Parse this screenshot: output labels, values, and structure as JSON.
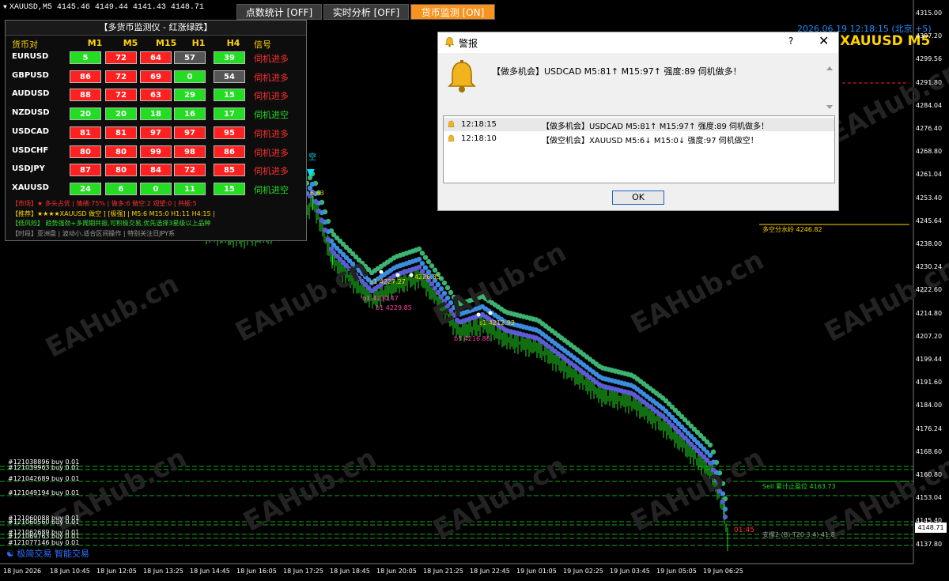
{
  "symbol_info": "XAUUSD,M5  4145.46 4149.44 4141.43 4148.71",
  "toggles": [
    {
      "label": "点数统计 [OFF]",
      "state": "off"
    },
    {
      "label": "实时分析 [OFF]",
      "state": "off"
    },
    {
      "label": "货币监测 [ON]",
      "state": "on"
    }
  ],
  "chart_date_label": "2026.06.19 12:18:15 (北京 +5)",
  "chart_title": "XAUUSD M5",
  "monitor": {
    "title": "【多货币监测仪 - 红涨绿跌】",
    "headers": [
      "货币对",
      "M1",
      "M5",
      "M15",
      "H1",
      "H4",
      "信号"
    ],
    "rows": [
      {
        "pair": "EURUSD",
        "vals": [
          "5",
          "72",
          "64",
          "57",
          "39"
        ],
        "colors": [
          "green",
          "red",
          "red",
          "gray",
          "green"
        ],
        "signal": "伺机进多",
        "sigcolor": "red"
      },
      {
        "pair": "GBPUSD",
        "vals": [
          "86",
          "72",
          "69",
          "0",
          "54"
        ],
        "colors": [
          "red",
          "red",
          "red",
          "green",
          "gray"
        ],
        "signal": "伺机进多",
        "sigcolor": "red"
      },
      {
        "pair": "AUDUSD",
        "vals": [
          "88",
          "72",
          "63",
          "29",
          "15"
        ],
        "colors": [
          "red",
          "red",
          "red",
          "green",
          "green"
        ],
        "signal": "伺机进多",
        "sigcolor": "red"
      },
      {
        "pair": "NZDUSD",
        "vals": [
          "20",
          "20",
          "18",
          "16",
          "17"
        ],
        "colors": [
          "green",
          "green",
          "green",
          "green",
          "green"
        ],
        "signal": "伺机进空",
        "sigcolor": "green"
      },
      {
        "pair": "USDCAD",
        "vals": [
          "81",
          "81",
          "97",
          "97",
          "95"
        ],
        "colors": [
          "red",
          "red",
          "red",
          "red",
          "red"
        ],
        "signal": "伺机进多",
        "sigcolor": "red"
      },
      {
        "pair": "USDCHF",
        "vals": [
          "80",
          "80",
          "99",
          "98",
          "86"
        ],
        "colors": [
          "red",
          "red",
          "red",
          "red",
          "red"
        ],
        "signal": "伺机进多",
        "sigcolor": "red"
      },
      {
        "pair": "USDJPY",
        "vals": [
          "87",
          "80",
          "84",
          "72",
          "85"
        ],
        "colors": [
          "red",
          "red",
          "red",
          "red",
          "red"
        ],
        "signal": "伺机进多",
        "sigcolor": "red"
      },
      {
        "pair": "XAUUSD",
        "vals": [
          "24",
          "6",
          "0",
          "11",
          "15"
        ],
        "colors": [
          "green",
          "green",
          "green",
          "green",
          "green"
        ],
        "signal": "伺机进空",
        "sigcolor": "green"
      }
    ],
    "notes": [
      {
        "text": "【市场】★ 多头占优 | 情绪:75% | 做多:6 做空:2 观望:0 | 共振:5",
        "color": "#ff3030"
      },
      {
        "text": "【推荐】★★★★XAUUSD 做空 ] [极强] | M5:6 M15:0 H1:11 H4:15 |",
        "color": "#ffd400"
      },
      {
        "text": "【低风险】 趋势强劲+多周期共振,可积极交易,优先选择3星级以上品种",
        "color": "#30e030"
      },
      {
        "text": "【时段】亚洲盘 | 波动小,适合区间操作 | 特别关注日JPY系",
        "color": "#9a9a9a"
      }
    ]
  },
  "alert": {
    "title": "警报",
    "help": "?",
    "close": "✕",
    "message": "【做多机会】USDCAD M5:81↑ M15:97↑ 强度:89 伺机做多！",
    "list": [
      {
        "time": "12:18:15",
        "msg": "【做多机会】USDCAD M5:81↑ M15:97↑ 强度:89 伺机做多！"
      },
      {
        "time": "12:18:10",
        "msg": "【做空机会】XAUUSD M5:6↓ M15:0↓ 强度:97 伺机做空！"
      }
    ],
    "ok": "OK"
  },
  "price_axis": [
    "4315.00",
    "4307.20",
    "4299.56",
    "4291.80",
    "4284.04",
    "4276.40",
    "4268.80",
    "4261.04",
    "4253.40",
    "4245.64",
    "4238.00",
    "4230.24",
    "4222.60",
    "4214.80",
    "4207.20",
    "4199.44",
    "4191.60",
    "4184.00",
    "4176.24",
    "4168.60",
    "4160.80",
    "4153.04",
    "4145.40",
    "4137.80"
  ],
  "current_price": "4148.71",
  "time_axis": [
    "18 Jun 2026",
    "18 Jun 10:45",
    "18 Jun 12:05",
    "18 Jun 13:25",
    "18 Jun 14:45",
    "18 Jun 16:05",
    "18 Jun 17:25",
    "18 Jun 18:45",
    "18 Jun 20:05",
    "18 Jun 21:25",
    "18 Jun 22:45",
    "19 Jun 01:05",
    "19 Jun 02:25",
    "19 Jun 03:45",
    "19 Jun 05:05",
    "19 Jun 06:25"
  ],
  "orders": [
    "#121038896 buy 0.01",
    "#121039963 buy 0.01",
    "#121042689 buy 0.01",
    "#121049194 buy 0.01",
    "#121060088 buy 0.01",
    "#121060560 buy 0.01",
    "#121062689 buy 0.01",
    "#121069763 buy 0.01",
    "#121077146 buy 0.01"
  ],
  "annotations": {
    "ma_line": "多空分水岭 4246.82",
    "sell_stop": "Sell 累计止盈位 4163.73",
    "support": "支撑2 (B) T20 3.4) 41.8",
    "countdown": "01:45",
    "s1": "s1 4227.27",
    "s1b": "4226.35",
    "b1a": "b1 4230.47",
    "b1b": "b1 4229.85",
    "s2": "s1 4212.93",
    "b2": "b1 4216.86",
    "p1": "6.63",
    "cjk_fragment": "空"
  },
  "watermark": "EAHub.cn",
  "brand_label": "极简交易 智能交易",
  "colors": {
    "up_red": "#ff2020",
    "down_green": "#22dd22",
    "accent_orange": "#f7931e",
    "ma_green": "#3cb371",
    "ma_blue1": "#3a8dde",
    "ma_blue2": "#5b5bd6"
  }
}
